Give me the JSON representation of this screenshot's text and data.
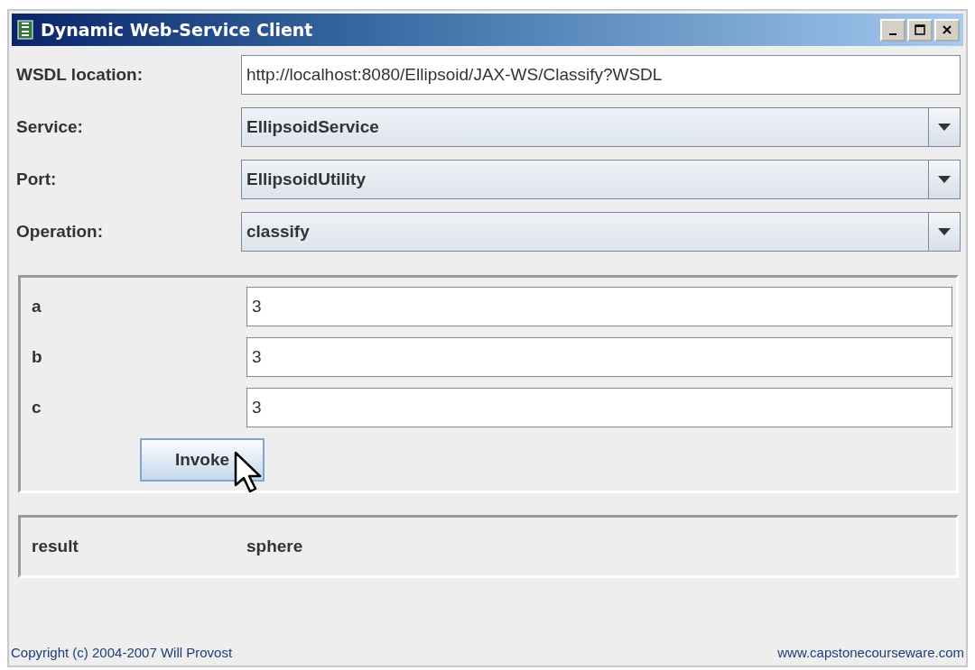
{
  "window": {
    "title": "Dynamic Web-Service Client"
  },
  "form": [
    {
      "kind": "text",
      "label": "WSDL location:",
      "value": "http://localhost:8080/Ellipsoid/JAX-WS/Classify?WSDL"
    },
    {
      "kind": "dropdown",
      "label": "Service:",
      "value": "EllipsoidService"
    },
    {
      "kind": "dropdown",
      "label": "Port:",
      "value": "EllipsoidUtility"
    },
    {
      "kind": "dropdown",
      "label": "Operation:",
      "value": "classify"
    }
  ],
  "parameters": [
    {
      "name": "a",
      "value": "3"
    },
    {
      "name": "b",
      "value": "3"
    },
    {
      "name": "c",
      "value": "3"
    }
  ],
  "invoke_button": {
    "label": "Invoke"
  },
  "result": {
    "label": "result",
    "value": "sphere"
  },
  "footer": {
    "copyright": "Copyright (c) 2004-2007 Will Provost",
    "website": "www.capstonecourseware.com"
  }
}
